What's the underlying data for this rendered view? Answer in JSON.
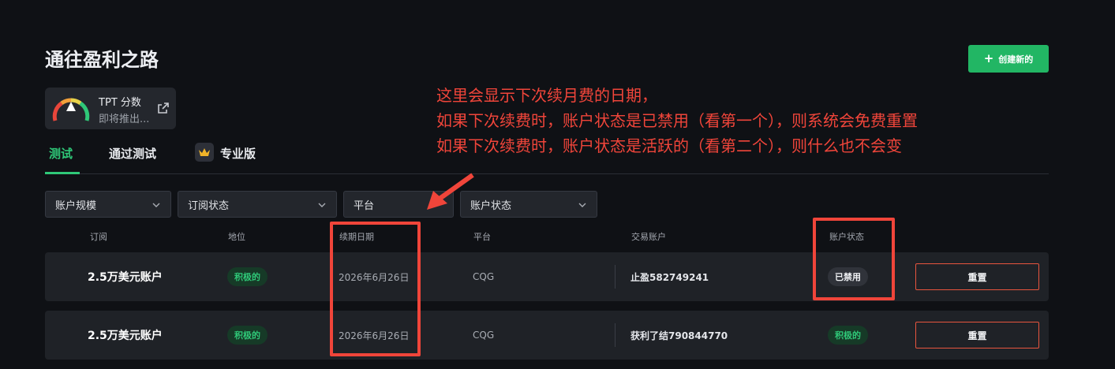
{
  "page": {
    "title": "通往盈利之路"
  },
  "create_button": {
    "label": "创建新的",
    "icon": "plus-icon"
  },
  "tpt": {
    "title": "TPT 分数",
    "subtitle": "即将推出...",
    "icon": "gauge-icon",
    "link_icon": "external-link-icon"
  },
  "tabs": [
    {
      "label": "测试",
      "active": true
    },
    {
      "label": "通过测试",
      "active": false
    },
    {
      "label": "专业版",
      "active": false,
      "icon": "crown-icon"
    }
  ],
  "filters": [
    {
      "label": "账户规模"
    },
    {
      "label": "订阅状态"
    },
    {
      "label": "平台"
    },
    {
      "label": "账户状态"
    }
  ],
  "columns": [
    "订阅",
    "地位",
    "续期日期",
    "平台",
    "交易账户",
    "账户状态"
  ],
  "rows": [
    {
      "subscription": "2.5万美元账户",
      "status": "积极的",
      "renewal": "2026年6月26日",
      "platform": "CQG",
      "account": "止盈582749241",
      "account_status": "已禁用",
      "action": "重置"
    },
    {
      "subscription": "2.5万美元账户",
      "status": "积极的",
      "renewal": "2026年6月26日",
      "platform": "CQG",
      "account": "获利了结790844770",
      "account_status": "积极的",
      "action": "重置"
    }
  ],
  "annotation": {
    "lines": [
      "这里会显示下次续月费的日期，",
      "如果下次续费时，账户状态是已禁用（看第一个），则系统会免费重置",
      "如果下次续费时，账户状态是活跃的（看第二个），则什么也不会变"
    ],
    "color": "#f0453a"
  },
  "colors": {
    "accent": "#22b664",
    "background": "#0f1115",
    "reset_border": "#e8553e"
  }
}
